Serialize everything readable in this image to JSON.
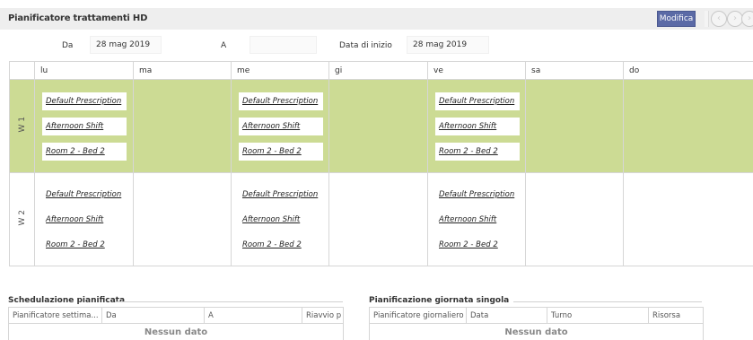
{
  "header": {
    "title": "Pianificatore trattamenti HD",
    "edit_label": "Modifica"
  },
  "filters": {
    "from_label": "Da",
    "from_value": "28 mag 2019",
    "to_label": "A",
    "to_value": "",
    "start_label": "Data di inizio",
    "start_value": "28 mag 2019"
  },
  "grid": {
    "days": [
      "lu",
      "ma",
      "me",
      "gi",
      "ve",
      "sa",
      "do"
    ],
    "weeks": [
      {
        "label": "W 1",
        "highlighted": true,
        "cells": [
          [
            "Default Prescription",
            "Afternoon Shift",
            "Room 2 - Bed 2"
          ],
          [],
          [
            "Default Prescription",
            "Afternoon Shift",
            "Room 2 - Bed 2"
          ],
          [],
          [
            "Default Prescription",
            "Afternoon Shift",
            "Room 2 - Bed 2"
          ],
          [],
          []
        ]
      },
      {
        "label": "W 2",
        "highlighted": false,
        "cells": [
          [
            "Default Prescription",
            "Afternoon Shift",
            "Room 2 - Bed 2"
          ],
          [],
          [
            "Default Prescription",
            "Afternoon Shift",
            "Room 2 - Bed 2"
          ],
          [],
          [
            "Default Prescription",
            "Afternoon Shift",
            "Room 2 - Bed 2"
          ],
          [],
          []
        ]
      }
    ]
  },
  "planned": {
    "title": "Schedulazione pianificata",
    "columns": [
      "Pianificatore settima...",
      "Da",
      "A",
      "Riavvio p"
    ],
    "empty_text": "Nessun dato"
  },
  "single_day": {
    "title": "Pianificazione giornata singola",
    "columns": [
      "Pianificatore giornaliero",
      "Data",
      "Turno",
      "Risorsa"
    ],
    "empty_text": "Nessun dato"
  },
  "colors": {
    "week_highlight": "#ccdb94",
    "accent": "#5b6aa6"
  }
}
